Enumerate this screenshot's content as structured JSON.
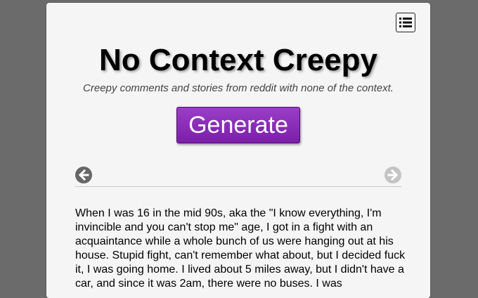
{
  "header": {
    "title": "No Context Creepy",
    "subtitle": "Creepy comments and stories from reddit with none of the context."
  },
  "actions": {
    "generate_label": "Generate"
  },
  "navigation": {
    "prev_icon": "arrow-left-circle",
    "next_icon": "arrow-right-circle",
    "next_enabled": false
  },
  "menu": {
    "icon": "list-icon"
  },
  "story": {
    "text": "When I was 16 in the mid 90s, aka the \"I know everything, I'm invincible and you can't stop me\" age, I got in a fight with an acquaintance while a whole bunch of us were hanging out at his house. Stupid fight, can't remember what about, but I decided fuck it, I was going home. I lived about 5 miles away, but I didn't have a car, and since it was 2am, there were no buses. I was"
  },
  "colors": {
    "page_background": "#6b6b6b",
    "card_background": "#f5f5f5",
    "button_purple": "#8a2bbd"
  }
}
